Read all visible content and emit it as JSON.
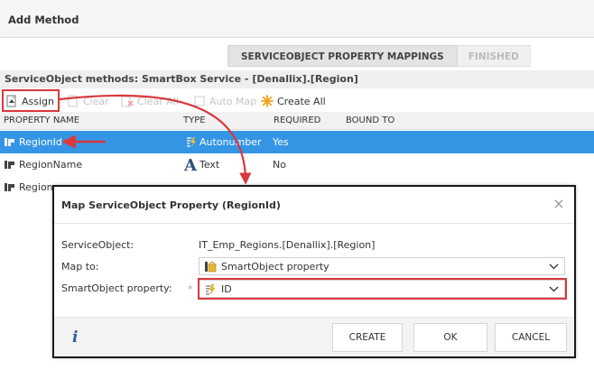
{
  "header": {
    "title": "Add Method"
  },
  "wizard": {
    "steps": [
      "SERVICEOBJECT PROPERTY MAPPINGS",
      "FINISHED"
    ]
  },
  "methods_bar": {
    "text": "ServiceObject methods: SmartBox Service - [Denallix].[Region]"
  },
  "toolbar": {
    "assign": "Assign",
    "clear": "Clear",
    "clear_all": "Clear All",
    "auto_map": "Auto Map",
    "create_all": "Create All"
  },
  "grid": {
    "columns": [
      "PROPERTY NAME",
      "TYPE",
      "REQUIRED",
      "BOUND TO"
    ],
    "rows": [
      {
        "name": "RegionId",
        "type": "Autonumber",
        "required": "Yes",
        "bound_to": ""
      },
      {
        "name": "RegionName",
        "type": "Text",
        "required": "No",
        "bound_to": ""
      },
      {
        "name": "Region",
        "type": "",
        "required": "",
        "bound_to": ""
      }
    ]
  },
  "dialog": {
    "title": "Map ServiceObject Property (RegionId)",
    "serviceobject_label": "ServiceObject:",
    "serviceobject_value": "IT_Emp_Regions.[Denallix].[Region]",
    "mapto_label": "Map to:",
    "mapto_value": "SmartObject property",
    "sop_label": "SmartObject property:",
    "sop_value": "ID",
    "required_mark": "*",
    "close_icon": "×",
    "buttons": {
      "create": "CREATE",
      "ok": "OK",
      "cancel": "CANCEL"
    },
    "info_icon": "i"
  },
  "colors": {
    "selection": "#3595e5",
    "highlight": "#d9383d",
    "accent_orange": "#f2a019"
  }
}
